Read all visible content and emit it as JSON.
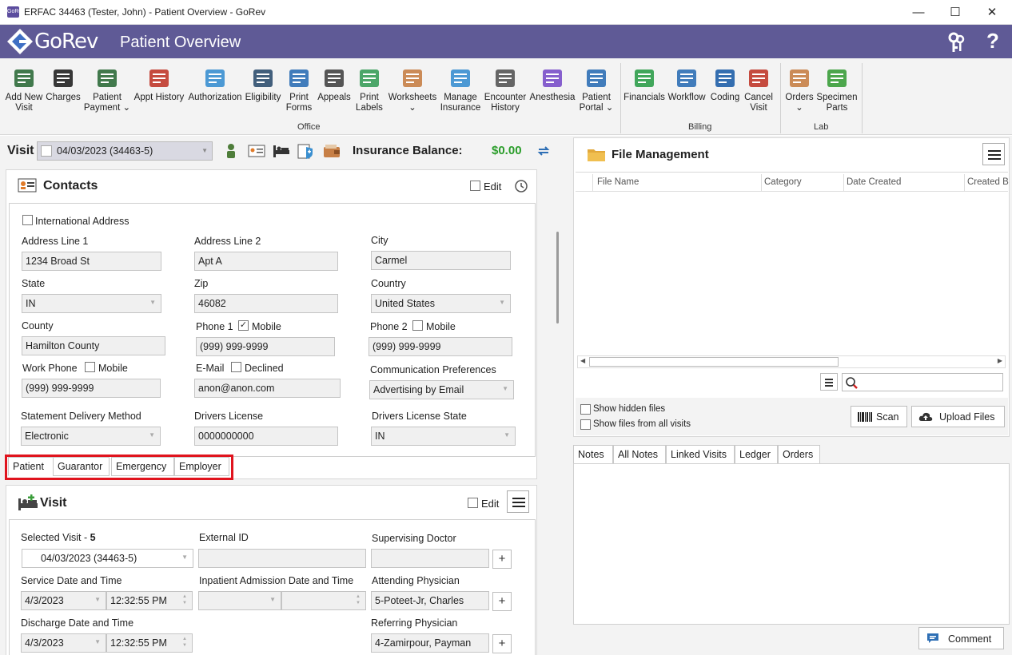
{
  "window": {
    "app_icon_text": "GoRev",
    "title": "ERFAC 34463 (Tester, John) - Patient Overview - GoRev",
    "minimize": "—",
    "maximize": "☐",
    "close": "✕"
  },
  "header": {
    "logo_text": "GoRev",
    "page_title": "Patient Overview",
    "help": "?"
  },
  "toolbar": {
    "office": [
      {
        "label": "Add New\nVisit",
        "icon": "add-visit-icon"
      },
      {
        "label": "Charges",
        "icon": "barcode-icon"
      },
      {
        "label": "Patient\nPayment ⌄",
        "icon": "patient-payment-icon"
      },
      {
        "label": "Appt History",
        "icon": "calendar-icon"
      },
      {
        "label": "Authorization",
        "icon": "shield-check-icon"
      },
      {
        "label": "Eligibility",
        "icon": "person-check-icon"
      },
      {
        "label": "Print\nForms",
        "icon": "printer-icon"
      },
      {
        "label": "Appeals",
        "icon": "briefcase-icon"
      },
      {
        "label": "Print\nLabels",
        "icon": "tag-icon"
      },
      {
        "label": "Worksheets\n⌄",
        "icon": "worksheets-icon"
      },
      {
        "label": "Manage\nInsurance",
        "icon": "insurance-icon"
      },
      {
        "label": "Encounter\nHistory",
        "icon": "encounter-history-icon"
      },
      {
        "label": "Anesthesia",
        "icon": "syringe-icon"
      },
      {
        "label": "Patient\nPortal ⌄",
        "icon": "globe-gear-icon"
      }
    ],
    "billing": [
      {
        "label": "Financials",
        "icon": "dollar-icon"
      },
      {
        "label": "Workflow",
        "icon": "workflow-icon"
      },
      {
        "label": "Coding",
        "icon": "coding-book-icon"
      },
      {
        "label": "Cancel\nVisit",
        "icon": "cancel-visit-icon"
      }
    ],
    "lab": [
      {
        "label": "Orders\n⌄",
        "icon": "orders-icon"
      },
      {
        "label": "Specimen\nParts",
        "icon": "specimen-icon"
      }
    ],
    "groups": {
      "office": "Office",
      "billing": "Billing",
      "lab": "Lab"
    }
  },
  "visitbar": {
    "label": "Visit",
    "selected": "04/03/2023 (34463-5)",
    "insurance_balance_label": "Insurance Balance:",
    "insurance_balance_value": "$0.00"
  },
  "contacts": {
    "title": "Contacts",
    "edit_label": "Edit",
    "international_address": "International Address",
    "address1_label": "Address Line 1",
    "address1": "1234 Broad St",
    "address2_label": "Address Line 2",
    "address2": "Apt A",
    "city_label": "City",
    "city": "Carmel",
    "state_label": "State",
    "state": "IN",
    "zip_label": "Zip",
    "zip": "46082",
    "country_label": "Country",
    "country": "United States",
    "county_label": "County",
    "county": "Hamilton County",
    "phone1_label": "Phone 1",
    "phone1_mobile_label": "Mobile",
    "phone1_mobile_checked": "✓",
    "phone1": "(999) 999-9999",
    "phone2_label": "Phone 2",
    "phone2_mobile_label": "Mobile",
    "phone2": "(999) 999-9999",
    "work_phone_label": "Work Phone",
    "work_mobile_label": "Mobile",
    "work_phone": "(999) 999-9999",
    "email_label": "E-Mail",
    "email_declined_label": "Declined",
    "email": "anon@anon.com",
    "comm_pref_label": "Communication Preferences",
    "comm_pref": "Advertising by Email",
    "statement_label": "Statement Delivery Method",
    "statement": "Electronic",
    "dl_label": "Drivers License",
    "dl": "0000000000",
    "dl_state_label": "Drivers License State",
    "dl_state": "IN",
    "tabs": [
      "Patient",
      "Guarantor",
      "Emergency",
      "Employer"
    ],
    "highlight_color": "#e0141e"
  },
  "visit": {
    "title": "Visit",
    "edit_label": "Edit",
    "selected_visit_label": "Selected Visit -",
    "selected_visit_count": "5",
    "selected_visit": "04/03/2023 (34463-5)",
    "external_id_label": "External ID",
    "supervising_label": "Supervising Doctor",
    "service_label": "Service Date and Time",
    "service_date": "4/3/2023",
    "service_time": "12:32:55 PM",
    "inpatient_label": "Inpatient Admission Date and Time",
    "attending_label": "Attending Physician",
    "attending": "5-Poteet-Jr, Charles",
    "discharge_label": "Discharge Date and Time",
    "discharge_date": "4/3/2023",
    "discharge_time": "12:32:55 PM",
    "referring_label": "Referring Physician",
    "referring": "4-Zamirpour, Payman",
    "plus": "+"
  },
  "files": {
    "title": "File Management",
    "columns": [
      "File Name",
      "Category",
      "Date Created",
      "Created B"
    ],
    "show_hidden": "Show hidden files",
    "show_all_visits": "Show files from all visits",
    "scan": "Scan",
    "upload": "Upload Files"
  },
  "notes": {
    "tabs": [
      "Notes",
      "All Notes",
      "Linked Visits",
      "Ledger",
      "Orders"
    ],
    "comment": "Comment"
  },
  "colors": {
    "header": "#5f5a96",
    "balance_green": "#2a9d2a"
  }
}
